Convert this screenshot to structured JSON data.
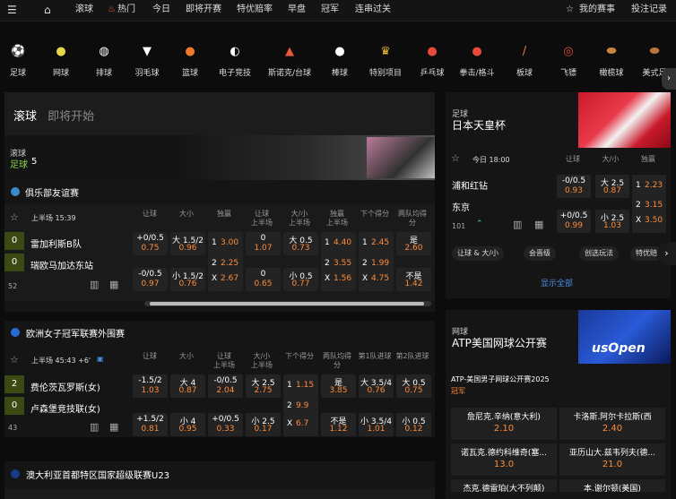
{
  "topnav": {
    "items": [
      "滚球",
      "热门",
      "今日",
      "即将开赛",
      "特优赔率",
      "早盘",
      "冠军",
      "连串过关"
    ],
    "right": [
      "我的赛事",
      "投注记录"
    ]
  },
  "sports": [
    "足球",
    "网球",
    "排球",
    "羽毛球",
    "篮球",
    "电子竞技",
    "斯诺克/台球",
    "棒球",
    "特别项目",
    "乒乓球",
    "拳击/格斗",
    "板球",
    "飞镖",
    "橄榄球",
    "美式足"
  ],
  "live": {
    "tabs": [
      "滚球",
      "即将开始"
    ],
    "banner_label": "滚球",
    "banner_sport": "足球",
    "banner_count": "5",
    "league1": {
      "name": "俱乐部友谊赛",
      "time": "上半场 15:39",
      "headers": [
        "让球",
        "大小",
        "独赢",
        "让球\n上半场",
        "大/小\n上半场",
        "独赢\n上半场",
        "下个得分",
        "两队均得\n分"
      ],
      "team1": "雷加利斯B队",
      "team2": "瑞欧马加达东站",
      "score1": "0",
      "score2": "0",
      "more": "52",
      "r1": {
        "h1": "+0/0.5",
        "o1": "0.75",
        "h2": "大 1.5/2",
        "o2": "0.96",
        "h3": "1",
        "o3": "3.00",
        "h4": "0",
        "o4": "1.07",
        "h5": "大 0.5",
        "o5": "0.73",
        "h6": "1",
        "o6": "4.40",
        "h7": "1",
        "o7": "2.45",
        "h8": "是",
        "o8": "2.60"
      },
      "rmid": {
        "h3": "2",
        "o3": "2.25",
        "h6": "2",
        "o6": "3.55",
        "h7": "2",
        "o7": "1.99"
      },
      "r2": {
        "h1": "-0/0.5",
        "o1": "0.97",
        "h2": "小 1.5/2",
        "o2": "0.76",
        "h3": "X",
        "o3": "2.67",
        "h4": "0",
        "o4": "0.65",
        "h5": "小 0.5",
        "o5": "0.77",
        "h6": "X",
        "o6": "1.56",
        "h7": "X",
        "o7": "4.75",
        "h8": "不是",
        "o8": "1.42"
      }
    },
    "league2": {
      "name": "欧洲女子冠军联赛外围赛",
      "time": "上半场 45:43 +6'",
      "headers": [
        "让球",
        "大小",
        "让球\n上半场",
        "大/小\n上半场",
        "下个得分",
        "两队均得\n分",
        "第1队进球",
        "第2队进球"
      ],
      "team1": "费伦茨瓦罗斯(女)",
      "team2": "卢森堡竞技联(女)",
      "score1": "2",
      "score2": "0",
      "more": "43",
      "r1": {
        "h1": "-1.5/2",
        "o1": "1.03",
        "h2": "大 4",
        "o2": "0.87",
        "h3": "-0/0.5",
        "o3": "2.04",
        "h4": "大 2.5",
        "o4": "2.75",
        "h5": "1",
        "o5": "1.15",
        "h6": "是",
        "o6": "3.85",
        "h7": "大 3.5/4",
        "o7": "0.76",
        "h8": "大 0.5",
        "o8": "0.75"
      },
      "rmid": {
        "h5": "2",
        "o5": "9.9"
      },
      "r2": {
        "h1": "+1.5/2",
        "o1": "0.81",
        "h2": "小 4",
        "o2": "0.95",
        "h3": "+0/0.5",
        "o3": "0.33",
        "h4": "小 2.5",
        "o4": "0.17",
        "h5": "X",
        "o5": "6.7",
        "h6": "不是",
        "o6": "1.12",
        "h7": "小 3.5/4",
        "o7": "1.01",
        "h8": "小 0.5",
        "o8": "0.12"
      }
    },
    "league3": {
      "name": "澳大利亚首都特区国家超级联赛U23"
    }
  },
  "featured": {
    "sport": "足球",
    "title": "日本天皇杯",
    "time": "今日 18:00",
    "headers": [
      "让球",
      "大/小",
      "独赢"
    ],
    "team1": "浦和红钻",
    "team2": "东京",
    "more": "101",
    "r1": {
      "h1": "-0/0.5",
      "o1": "0.93",
      "h2": "大 2.5",
      "o2": "0.87",
      "h3": "1",
      "o3": "2.23"
    },
    "rmid": {
      "h3": "2",
      "o3": "3.15"
    },
    "r2": {
      "h1": "+0/0.5",
      "o1": "0.99",
      "h2": "小 2.5",
      "o2": "1.03",
      "h3": "X",
      "o3": "3.50"
    },
    "filters": [
      "让球 & 大/小",
      "会晋级",
      "创选玩法",
      "特优赔"
    ],
    "show_all": "显示全部"
  },
  "tennis": {
    "sport": "网球",
    "title": "ATP美国网球公开赛",
    "event": "ATP-美国男子网球公开赛2025",
    "market": "冠军",
    "cells": [
      {
        "name": "詹尼克.辛纳(意大利)",
        "odds": "2.10"
      },
      {
        "name": "卡洛斯.阿尔卡拉斯(西",
        "odds": "2.40"
      },
      {
        "name": "诺瓦克.德约科维奇(塞...",
        "odds": "13.0"
      },
      {
        "name": "亚历山大.兹韦列夫(德...",
        "odds": "21.0"
      },
      {
        "name": "杰克.德雷珀(大不列颠)",
        "odds": ""
      },
      {
        "name": "本.谢尔顿(美国)",
        "odds": ""
      }
    ]
  },
  "colors": {
    "accent": "#ff8c3a",
    "green": "#8ad14a",
    "link": "#4a90e2"
  }
}
